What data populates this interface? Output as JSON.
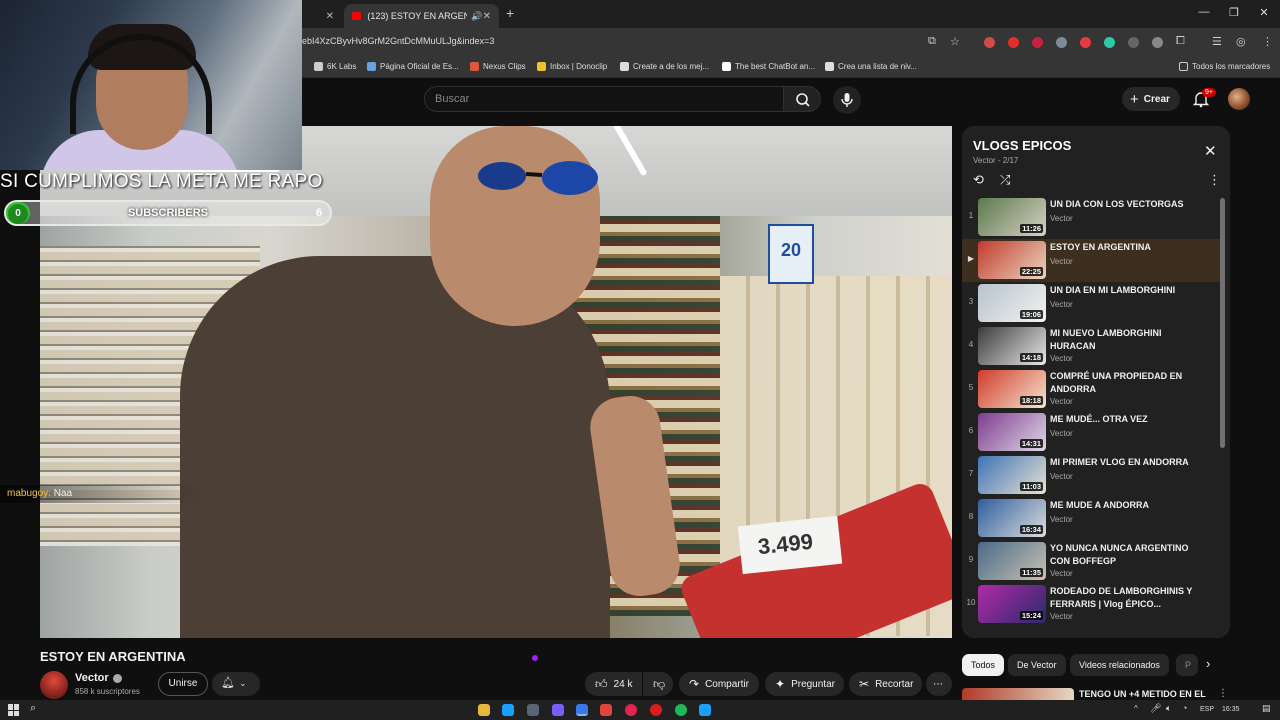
{
  "browser": {
    "tabs": [
      {
        "label": "",
        "active": false
      },
      {
        "label": "(123) ESTOY EN ARGENTIN",
        "active": true
      }
    ],
    "new_tab": "+",
    "url": "ebI4XzCByvHv8GrM2GntDcMMuULJg&index=3",
    "bookmarks": [
      {
        "label": "6K Labs",
        "color": "#cccccc"
      },
      {
        "label": "Página Oficial de Es...",
        "color": "#6aa0e0"
      },
      {
        "label": "Nexus Clips",
        "color": "#e0563a"
      },
      {
        "label": "Inbox | Donoclip",
        "color": "#f2c12e"
      },
      {
        "label": "Create a de los mej...",
        "color": "#dddddd"
      },
      {
        "label": "The best ChatBot an...",
        "color": "#ffffff"
      },
      {
        "label": "Crea una lista de niv...",
        "color": "#dddddd"
      }
    ],
    "all_bookmarks": "Todos los marcadores"
  },
  "youtube": {
    "search_placeholder": "Buscar",
    "create_label": "Crear",
    "notifications_badge": "9+"
  },
  "stream_overlay": {
    "banner_text": "SI CUMPLIMOS LA META ME RAPO",
    "subscriber_current": "0",
    "subscriber_label": "SUBSCRIBERS",
    "subscriber_goal": "6",
    "subscriber_progress": 0.0,
    "chat_user": "mabugoy:",
    "chat_message": " Naa"
  },
  "video": {
    "title": "ESTOY EN ARGENTINA",
    "channel_name": "Vector",
    "channel_subs": "858 k suscriptores",
    "join_label": "Unirse",
    "likes": "24 k",
    "share_label": "Compartir",
    "ask_label": "Preguntar",
    "clip_label": "Recortar",
    "scene_price": "3.499",
    "scene_sign": "20"
  },
  "playlist": {
    "title": "VLOGS EPICOS",
    "subtitle": "Vector - 2/17",
    "items": [
      {
        "index": "1",
        "title": "UN DIA CON LOS VECTORGAS",
        "channel": "Vector",
        "duration": "11:26",
        "current": false,
        "colors": [
          "#5a7a4c",
          "#d8d1c3"
        ]
      },
      {
        "index": "▶",
        "title": "ESTOY EN ARGENTINA",
        "channel": "Vector",
        "duration": "22:25",
        "current": true,
        "colors": [
          "#c33a2c",
          "#e8d8c0"
        ]
      },
      {
        "index": "3",
        "title": "UN DIA EN MI LAMBORGHINI",
        "channel": "Vector",
        "duration": "19:06",
        "current": false,
        "colors": [
          "#b7c3cc",
          "#f2f2f2"
        ]
      },
      {
        "index": "4",
        "title": "MI NUEVO LAMBORGHINI HURACAN",
        "channel": "Vector",
        "duration": "14:18",
        "current": false,
        "colors": [
          "#3b3b3b",
          "#e9e9e9"
        ]
      },
      {
        "index": "5",
        "title": "COMPRÉ UNA PROPIEDAD EN ANDORRA",
        "channel": "Vector",
        "duration": "18:18",
        "current": false,
        "colors": [
          "#d13b2b",
          "#f5e5cf"
        ]
      },
      {
        "index": "6",
        "title": "ME MUDÉ... OTRA VEZ",
        "channel": "Vector",
        "duration": "14:31",
        "current": false,
        "colors": [
          "#7d3c8e",
          "#e0d9e6"
        ]
      },
      {
        "index": "7",
        "title": "MI PRIMER VLOG EN ANDORRA",
        "channel": "Vector",
        "duration": "11:03",
        "current": false,
        "colors": [
          "#3d73b8",
          "#e9e2d2"
        ]
      },
      {
        "index": "8",
        "title": "ME MUDE A ANDORRA",
        "channel": "Vector",
        "duration": "16:34",
        "current": false,
        "colors": [
          "#2f5f9e",
          "#dcdcdc"
        ]
      },
      {
        "index": "9",
        "title": "YO NUNCA NUNCA ARGENTINO CON BOFFEGP",
        "channel": "Vector",
        "duration": "11:35",
        "current": false,
        "colors": [
          "#4a6a8a",
          "#c9c2b0"
        ]
      },
      {
        "index": "10",
        "title": "RODEADO DE LAMBORGHINIS Y FERRARIS | Vlog ÉPICO...",
        "channel": "Vector",
        "duration": "15:24",
        "current": false,
        "colors": [
          "#b02aa8",
          "#2a2a6a"
        ]
      }
    ]
  },
  "chips": [
    {
      "label": "Todos",
      "active": true
    },
    {
      "label": "De Vector",
      "active": false
    },
    {
      "label": "Videos relacionados",
      "active": false
    },
    {
      "label": "P",
      "active": false
    }
  ],
  "recommended": {
    "title": "TENGO UN +4 METIDO EN EL"
  },
  "taskbar": {
    "lang": "ESP",
    "time": "16:35"
  }
}
